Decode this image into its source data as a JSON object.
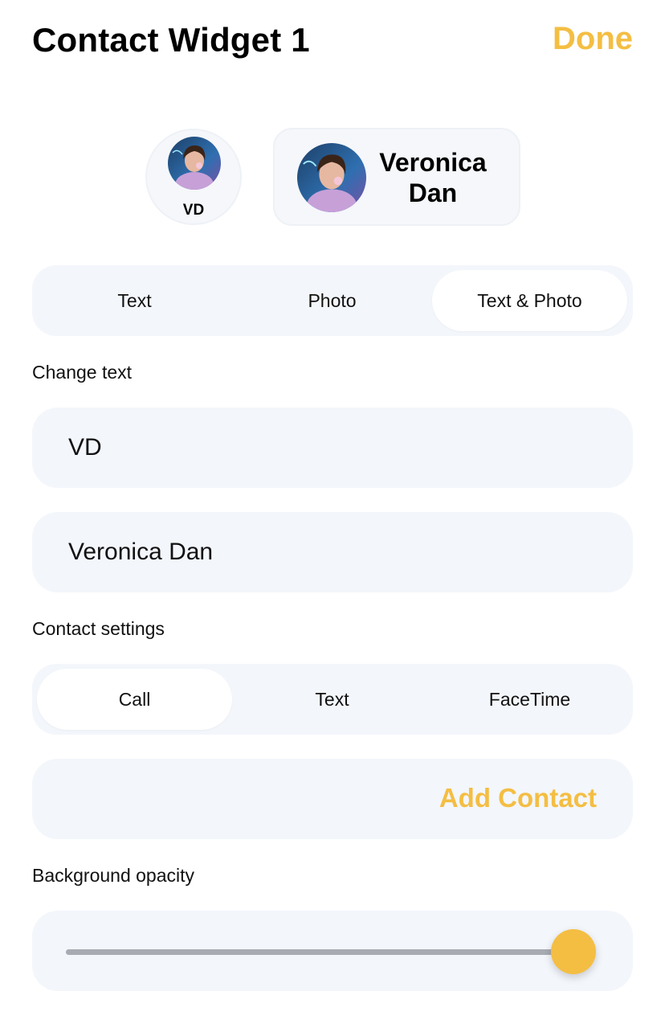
{
  "header": {
    "title": "Contact Widget 1",
    "done_label": "Done"
  },
  "preview": {
    "initials": "VD",
    "name_line1": "Veronica",
    "name_line2": "Dan"
  },
  "display_mode": {
    "options": [
      "Text",
      "Photo",
      "Text & Photo"
    ],
    "selected": "Text & Photo"
  },
  "change_text": {
    "label": "Change text",
    "short_value": "VD",
    "full_value": "Veronica Dan"
  },
  "contact_settings": {
    "label": "Contact settings",
    "options": [
      "Call",
      "Text",
      "FaceTime"
    ],
    "selected": "Call",
    "add_contact_label": "Add Contact"
  },
  "opacity": {
    "label": "Background opacity",
    "value_fraction": 0.96
  },
  "colors": {
    "accent": "#F4BE43",
    "card": "#f3f6fb"
  }
}
